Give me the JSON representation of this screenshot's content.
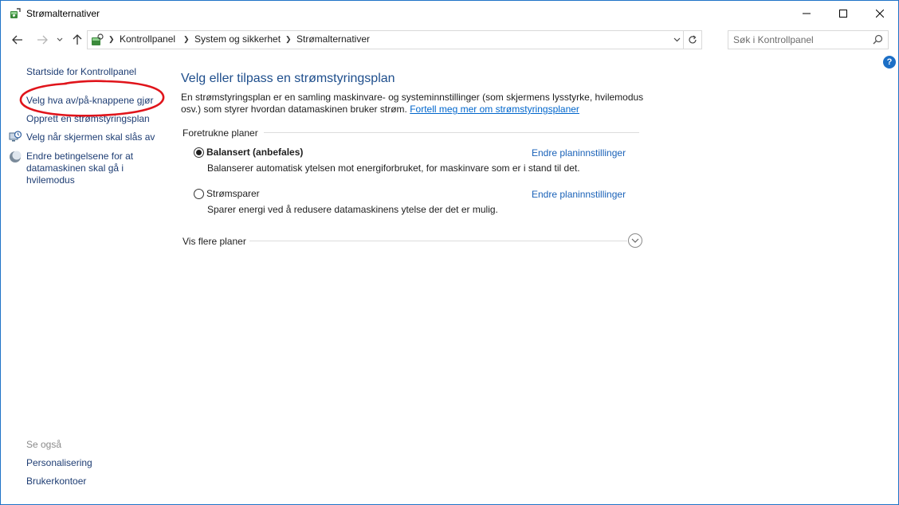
{
  "window": {
    "title": "Strømalternativer",
    "icon": "power-options-icon",
    "controls": [
      "minimize-icon",
      "maximize-icon",
      "close-icon"
    ]
  },
  "nav": {
    "back": "arrow-left-icon",
    "forward": "arrow-right-icon",
    "recent": "chevron-down-icon",
    "up": "arrow-up-icon"
  },
  "address": {
    "breadcrumbs": [
      "Kontrollpanel",
      "System og sikkerhet",
      "Strømalternativer"
    ]
  },
  "search": {
    "placeholder": "Søk i Kontrollpanel"
  },
  "help": {
    "label": "?"
  },
  "sidebar": {
    "home": "Startside for Kontrollpanel",
    "items": [
      {
        "label": "Velg hva av/på-knappene gjør",
        "icon": null
      },
      {
        "label": "Opprett en strømstyringsplan",
        "icon": null
      },
      {
        "label": "Velg når skjermen skal slås av",
        "icon": "monitor-clock-icon"
      },
      {
        "label": "Endre betingelsene for at datamaskinen skal gå i hvilemodus",
        "icon": "moon-icon"
      }
    ],
    "see_also": {
      "heading": "Se også",
      "links": [
        "Personalisering",
        "Brukerkontoer"
      ]
    }
  },
  "annotation": {
    "color": "#e0141b"
  },
  "main": {
    "title": "Velg eller tilpass en strømstyringsplan",
    "description": "En strømstyringsplan er en samling maskinvare- og systeminnstillinger (som skjermens lysstyrke, hvilemodus osv.) som styrer hvordan datamaskinen bruker strøm.",
    "learn_more": "Fortell meg mer om strømstyringsplaner",
    "preferred_heading": "Foretrukne planer",
    "plans": [
      {
        "name": "Balansert (anbefales)",
        "selected": true,
        "description": "Balanserer automatisk ytelsen mot energiforbruket, for maskinvare som er i stand til det.",
        "change_link": "Endre planinnstillinger"
      },
      {
        "name": "Strømsparer",
        "selected": false,
        "description": "Sparer energi ved å redusere datamaskinens ytelse der det er mulig.",
        "change_link": "Endre planinnstillinger"
      }
    ],
    "more_plans": "Vis flere planer"
  },
  "colors": {
    "accent_border": "#1f73c7",
    "heading_blue": "#1e4e8c",
    "link_blue": "#1a62b8"
  }
}
